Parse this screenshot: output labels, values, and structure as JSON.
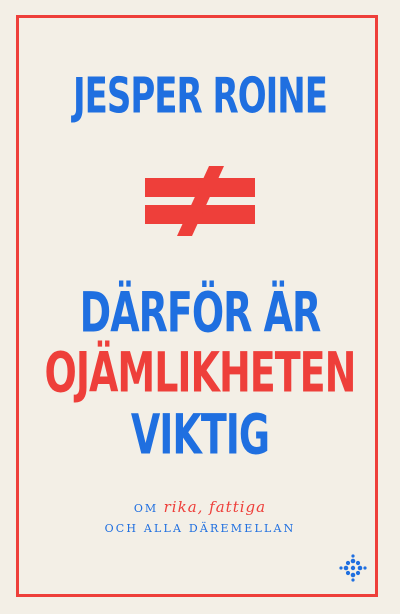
{
  "cover": {
    "author": "JESPER ROINE",
    "title_line_1": "DÄRFÖR ÄR",
    "title_line_2": "OJÄMLIKHETEN",
    "title_line_3": "VIKTIG",
    "subtitle_part_1": "OM",
    "subtitle_part_2": "rika, fattiga",
    "subtitle_line_2": "OCH ALLA DÄREMELLAN"
  },
  "symbols": {
    "center": "not-equal-icon",
    "publisher": "asterisk-flower-icon"
  },
  "colors": {
    "background": "#f3efe6",
    "blue": "#1f6fe0",
    "red": "#ee3f3a"
  }
}
